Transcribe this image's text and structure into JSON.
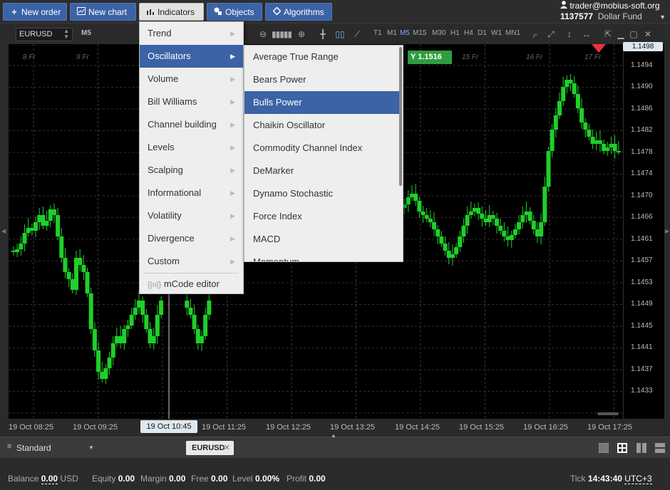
{
  "toolbar": {
    "new_order": "New order",
    "new_chart": "New chart",
    "indicators": "Indicators",
    "objects": "Objects",
    "algorithms": "Algorithms"
  },
  "account": {
    "email": "trader@mobius-soft.org",
    "number": "1137577",
    "name": "Dollar Fund"
  },
  "chart_toolbar": {
    "symbol": "EURUSD",
    "timeframe": "M5",
    "timeframes": [
      "T1",
      "M1",
      "M5",
      "M15",
      "M30",
      "H1",
      "H4",
      "D1",
      "W1",
      "MN1"
    ],
    "active_timeframe": "M5"
  },
  "chart": {
    "day_labels": [
      "8 Fr",
      "9 Fr",
      "15 Fr",
      "16 Fr",
      "17 Fr"
    ],
    "price_labels": [
      "1.1494",
      "1.1490",
      "1.1486",
      "1.1482",
      "1.1478",
      "1.1474",
      "1.1470",
      "1.1466",
      "1.1461",
      "1.1457",
      "1.1453",
      "1.1449",
      "1.1445",
      "1.1441",
      "1.1437",
      "1.1433"
    ],
    "current_price": "1.1498",
    "buy_label": "Y 1.1516",
    "time_labels": [
      "19 Oct 08:25",
      "19 Oct 09:25",
      "19 Oct 11:25",
      "19 Oct 12:25",
      "19 Oct 13:25",
      "19 Oct 14:25",
      "19 Oct 15:25",
      "19 Oct 16:25",
      "19 Oct 17:25"
    ],
    "crosshair_time": "19 Oct 10:45",
    "candle_color": "#1fcf2a"
  },
  "indicators_menu": {
    "items": [
      {
        "label": "Trend"
      },
      {
        "label": "Oscillators"
      },
      {
        "label": "Volume"
      },
      {
        "label": "Bill Williams"
      },
      {
        "label": "Channel building"
      },
      {
        "label": "Levels"
      },
      {
        "label": "Scalping"
      },
      {
        "label": "Informational"
      },
      {
        "label": "Volatility"
      },
      {
        "label": "Divergence"
      },
      {
        "label": "Custom"
      }
    ],
    "selected": "Oscillators",
    "editor_label": "mCode editor"
  },
  "oscillators_menu": {
    "items": [
      "Average True Range",
      "Bears Power",
      "Bulls Power",
      "Chaikin Oscillator",
      "Commodity Channel Index",
      "DeMarker",
      "Dynamo Stochastic",
      "Force Index",
      "MACD",
      "Momentum"
    ],
    "selected": "Bulls Power"
  },
  "bottom_tabs": {
    "workspace": "Standard",
    "tab": "EURUSD"
  },
  "status": {
    "balance_label": "Balance",
    "balance_value": "0.00",
    "balance_currency": "USD",
    "equity_label": "Equity",
    "equity_value": "0.00",
    "margin_label": "Margin",
    "margin_value": "0.00",
    "free_label": "Free",
    "free_value": "0.00",
    "level_label": "Level",
    "level_value": "0.00%",
    "profit_label": "Profit",
    "profit_value": "0.00",
    "tick_label": "Tick",
    "tick_time": "14:43:40",
    "timezone": "UTC+3"
  },
  "colors": {
    "accent": "#3b63a6",
    "buy": "#2e9d3f",
    "marker": "#e8323c"
  }
}
